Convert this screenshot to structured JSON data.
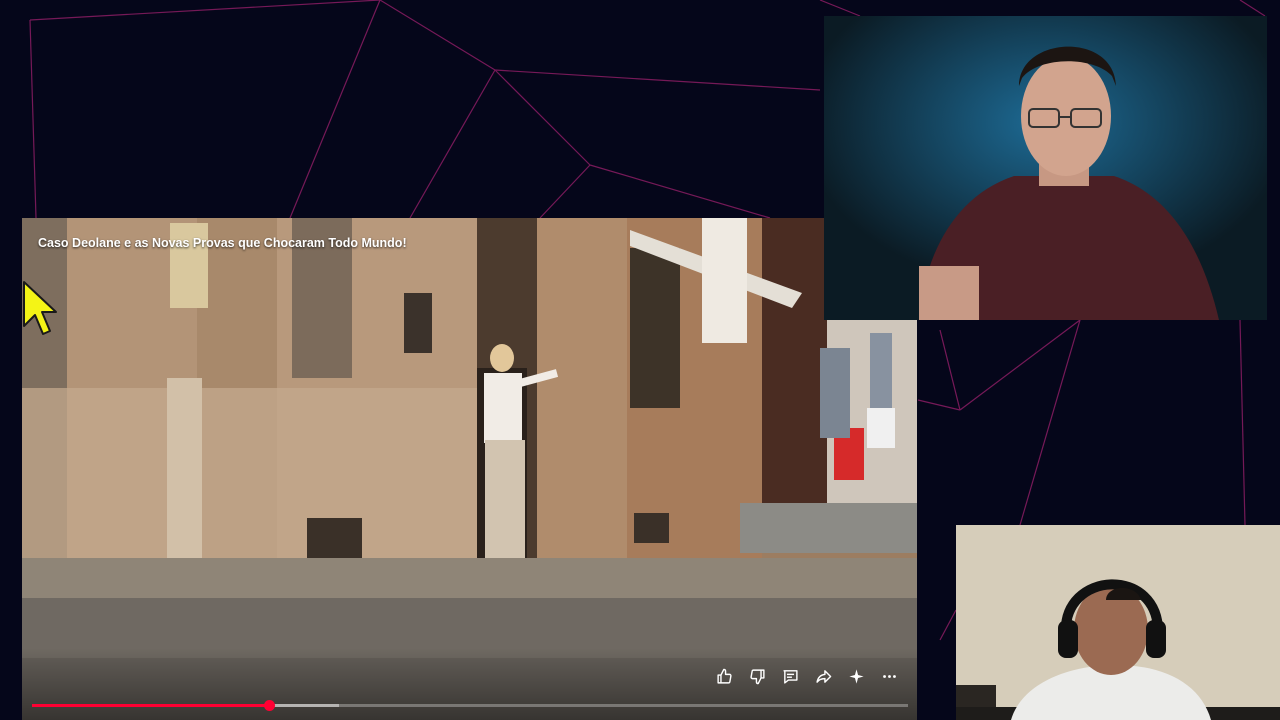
{
  "video": {
    "title": "Caso Deolane e as Novas Provas que Chocaram Todo Mundo!",
    "progress_fraction": 0.27,
    "buffered_fraction": 0.35
  },
  "action_icons": [
    "thumbs-up-icon",
    "thumbs-down-icon",
    "comment-icon",
    "share-icon",
    "sparkle-icon",
    "more-icon"
  ],
  "colors": {
    "background": "#05061a",
    "grid_lines": "#a3206a",
    "progress": "#ff0033"
  }
}
